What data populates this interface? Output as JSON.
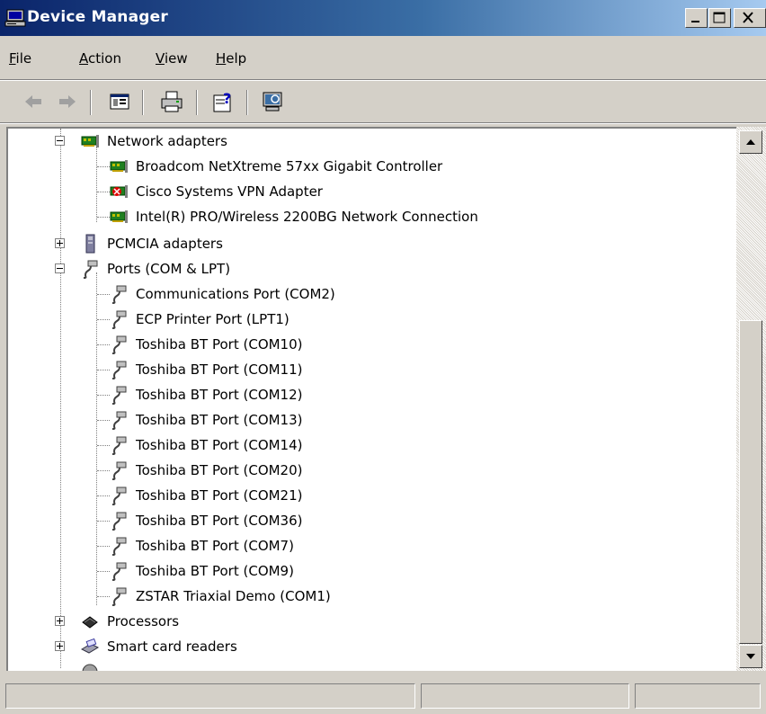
{
  "window": {
    "title": "Device Manager"
  },
  "title_controls": {
    "minimize": "minimize-icon",
    "maximize": "maximize-icon",
    "close": "close-icon"
  },
  "menu": [
    {
      "label": "File",
      "accel": "F",
      "rest": "ile"
    },
    {
      "label": "Action",
      "accel": "A",
      "rest": "ction"
    },
    {
      "label": "View",
      "accel": "V",
      "rest": "iew"
    },
    {
      "label": "Help",
      "accel": "H",
      "rest": "elp"
    }
  ],
  "toolbar": [
    "back-arrow-icon",
    "forward-arrow-icon",
    "show-hide-console-tree-icon",
    "print-icon",
    "help-icon",
    "scan-hardware-icon"
  ],
  "tree": {
    "network_adapters": {
      "label": "Network adapters",
      "children": [
        "Broadcom NetXtreme 57xx Gigabit Controller",
        "Cisco Systems VPN Adapter",
        "Intel(R) PRO/Wireless 2200BG Network Connection"
      ]
    },
    "pcmcia": {
      "label": "PCMCIA adapters"
    },
    "ports": {
      "label": "Ports (COM & LPT)",
      "children": [
        "Communications Port (COM2)",
        "ECP Printer Port (LPT1)",
        "Toshiba BT Port (COM10)",
        "Toshiba BT Port (COM11)",
        "Toshiba BT Port (COM12)",
        "Toshiba BT Port (COM13)",
        "Toshiba BT Port (COM14)",
        "Toshiba BT Port (COM20)",
        "Toshiba BT Port (COM21)",
        "Toshiba BT Port (COM36)",
        "Toshiba BT Port (COM7)",
        "Toshiba BT Port (COM9)",
        "ZSTAR Triaxial Demo (COM1)"
      ]
    },
    "processors": {
      "label": "Processors"
    },
    "smart_card": {
      "label": "Smart card readers"
    }
  },
  "colors": {
    "title_start": "#0a246a",
    "title_end": "#a6caf0",
    "face": "#d4d0c8"
  }
}
